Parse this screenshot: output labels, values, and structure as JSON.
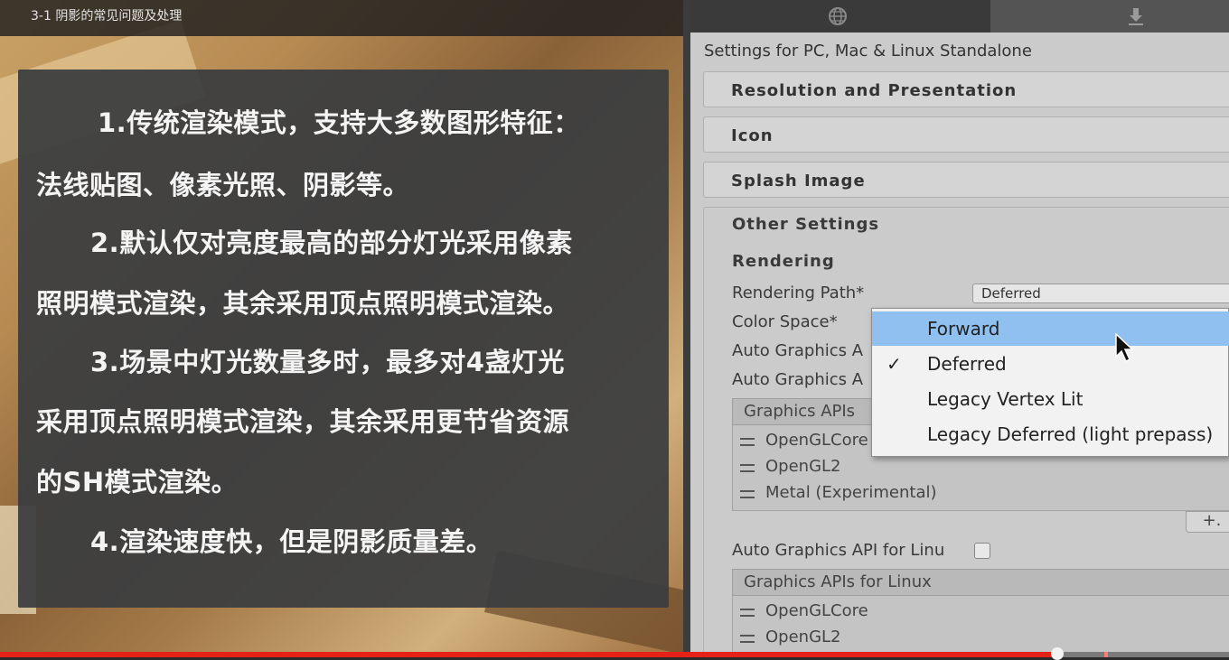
{
  "video": {
    "title": "3-1 阴影的常见问题及处理",
    "progress_fraction": 0.86
  },
  "slide": {
    "lines": [
      "1.传统渲染模式，支持大多数图形特征：",
      "法线贴图、像素光照、阴影等。",
      "2.默认仅对亮度最高的部分灯光采用像素",
      "照明模式渲染，其余采用顶点照明模式渲染。",
      "3.场景中灯光数量多时，最多对4盏灯光",
      "采用顶点照明模式渲染，其余采用更节省资源",
      "的SH模式渲染。",
      "4.渲染速度快，但是阴影质量差。"
    ]
  },
  "inspector": {
    "tabs": [
      {
        "icon": "globe-icon"
      },
      {
        "icon": "download-icon"
      }
    ],
    "settings_for": "Settings for PC, Mac & Linux Standalone",
    "sections": {
      "resolution": "Resolution and Presentation",
      "icon": "Icon",
      "splash": "Splash Image",
      "other": "Other Settings"
    },
    "rendering_header": "Rendering",
    "rendering_path_label": "Rendering Path*",
    "rendering_path_value": "Deferred",
    "color_space_label": "Color Space*",
    "auto_graphics_1": "Auto Graphics A",
    "auto_graphics_2": "Auto Graphics A",
    "graphics_apis_header": "Graphics APIs",
    "graphics_apis": [
      "OpenGLCore",
      "OpenGL2",
      "Metal (Experimental)"
    ],
    "plus_button": "+.",
    "auto_graphics_linux": "Auto Graphics API for Linu",
    "graphics_apis_linux_header": "Graphics APIs for Linux",
    "graphics_apis_linux": [
      "OpenGLCore",
      "OpenGL2"
    ]
  },
  "dropdown": {
    "items": [
      {
        "label": "Forward",
        "checked": false,
        "highlighted": true
      },
      {
        "label": "Deferred",
        "checked": true,
        "highlighted": false
      },
      {
        "label": "Legacy Vertex Lit",
        "checked": false,
        "highlighted": false
      },
      {
        "label": "Legacy Deferred (light prepass)",
        "checked": false,
        "highlighted": false
      }
    ],
    "check_glyph": "✓"
  },
  "colors": {
    "progress": "#e62117",
    "menu_highlight": "#8fc0ef",
    "slide_panel": "#3c3e40"
  }
}
